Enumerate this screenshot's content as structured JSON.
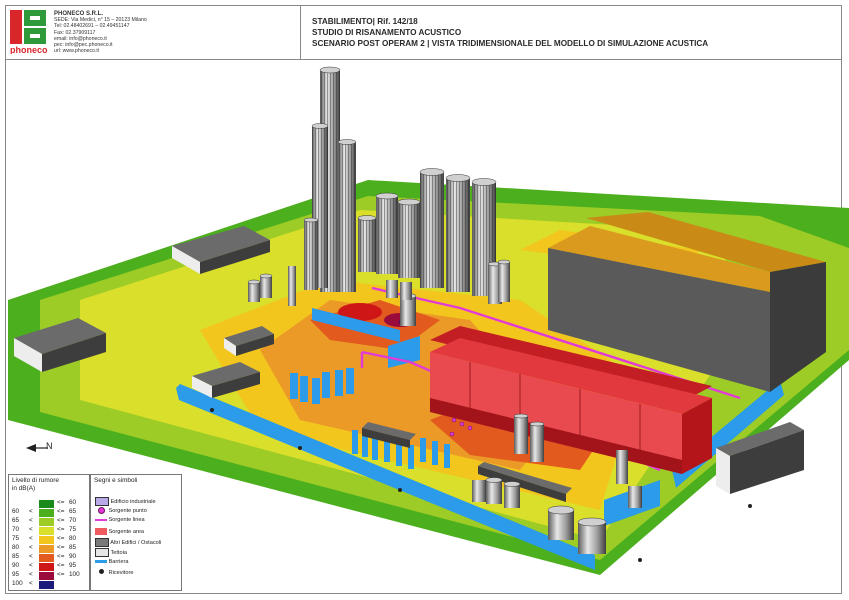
{
  "header": {
    "company": {
      "name": "PHONECO S.R.L.",
      "lines": [
        "SEDE: Via Medici, n° 15 – 20123 Milano",
        "Tel: 02.48402691 – 02.49451147",
        "Fax: 02.37909117",
        "email: info@phoneco.it",
        "pec: info@pec.phoneco.it",
        "url: www.phoneco.it"
      ],
      "logo_text": "phoneco"
    },
    "title_line1": "STABILIMENTO| Rif. 142/18",
    "title_line2": "STUDIO DI RISANAMENTO ACUSTICO",
    "title_line3": "SCENARIO POST OPERAM 2 | VISTA TRIDIMENSIONALE DEL MODELLO DI SIMULAZIONE ACUSTICA"
  },
  "noise_legend": {
    "title": "Livello di rumore",
    "unit": "in dB(A)",
    "rows": [
      {
        "lo": "",
        "op1": "",
        "op2": "<=",
        "hi": "60",
        "color": "#1a8a1a"
      },
      {
        "lo": "60",
        "op1": "<",
        "op2": "<=",
        "hi": "65",
        "color": "#4caf1e"
      },
      {
        "lo": "65",
        "op1": "<",
        "op2": "<=",
        "hi": "70",
        "color": "#9ccc25"
      },
      {
        "lo": "70",
        "op1": "<",
        "op2": "<=",
        "hi": "75",
        "color": "#d9df2a"
      },
      {
        "lo": "75",
        "op1": "<",
        "op2": "<=",
        "hi": "80",
        "color": "#f3c61e"
      },
      {
        "lo": "80",
        "op1": "<",
        "op2": "<=",
        "hi": "85",
        "color": "#eb9a28"
      },
      {
        "lo": "85",
        "op1": "<",
        "op2": "<=",
        "hi": "90",
        "color": "#e25a1e"
      },
      {
        "lo": "90",
        "op1": "<",
        "op2": "<=",
        "hi": "95",
        "color": "#cf1616"
      },
      {
        "lo": "95",
        "op1": "<",
        "op2": "<=",
        "hi": "100",
        "color": "#9a0b3c"
      },
      {
        "lo": "100",
        "op1": "<",
        "op2": "",
        "hi": "",
        "color": "#1c1a7a"
      }
    ]
  },
  "symbols_legend": {
    "title": "Segni e simboli",
    "items": [
      {
        "label": "Edificio industriale",
        "icon": "industrial-building-swatch"
      },
      {
        "label": "Sorgente punto",
        "icon": "point-source-symbol"
      },
      {
        "label": "Sorgente linea",
        "icon": "line-source-symbol"
      },
      {
        "label": "Sorgente area",
        "icon": "area-source-swatch"
      },
      {
        "label": "Altri Edifici / Ostacoli",
        "icon": "other-buildings-swatch"
      },
      {
        "label": "Tettoia",
        "icon": "canopy-swatch"
      },
      {
        "label": "Barriera",
        "icon": "barrier-symbol"
      },
      {
        "label": "Ricevitore",
        "icon": "receiver-symbol"
      }
    ]
  },
  "north_arrow": {
    "label": "N"
  },
  "colors": {
    "green": "#4caf1e",
    "yellow": "#d9df2a",
    "orange": "#eb9a28",
    "red": "#cf1616",
    "barrier": "#2b9bea",
    "industrial_red": "#e2393e",
    "warehouse_roof": "#d99a1e",
    "gray_building": "#5a5a5a"
  }
}
